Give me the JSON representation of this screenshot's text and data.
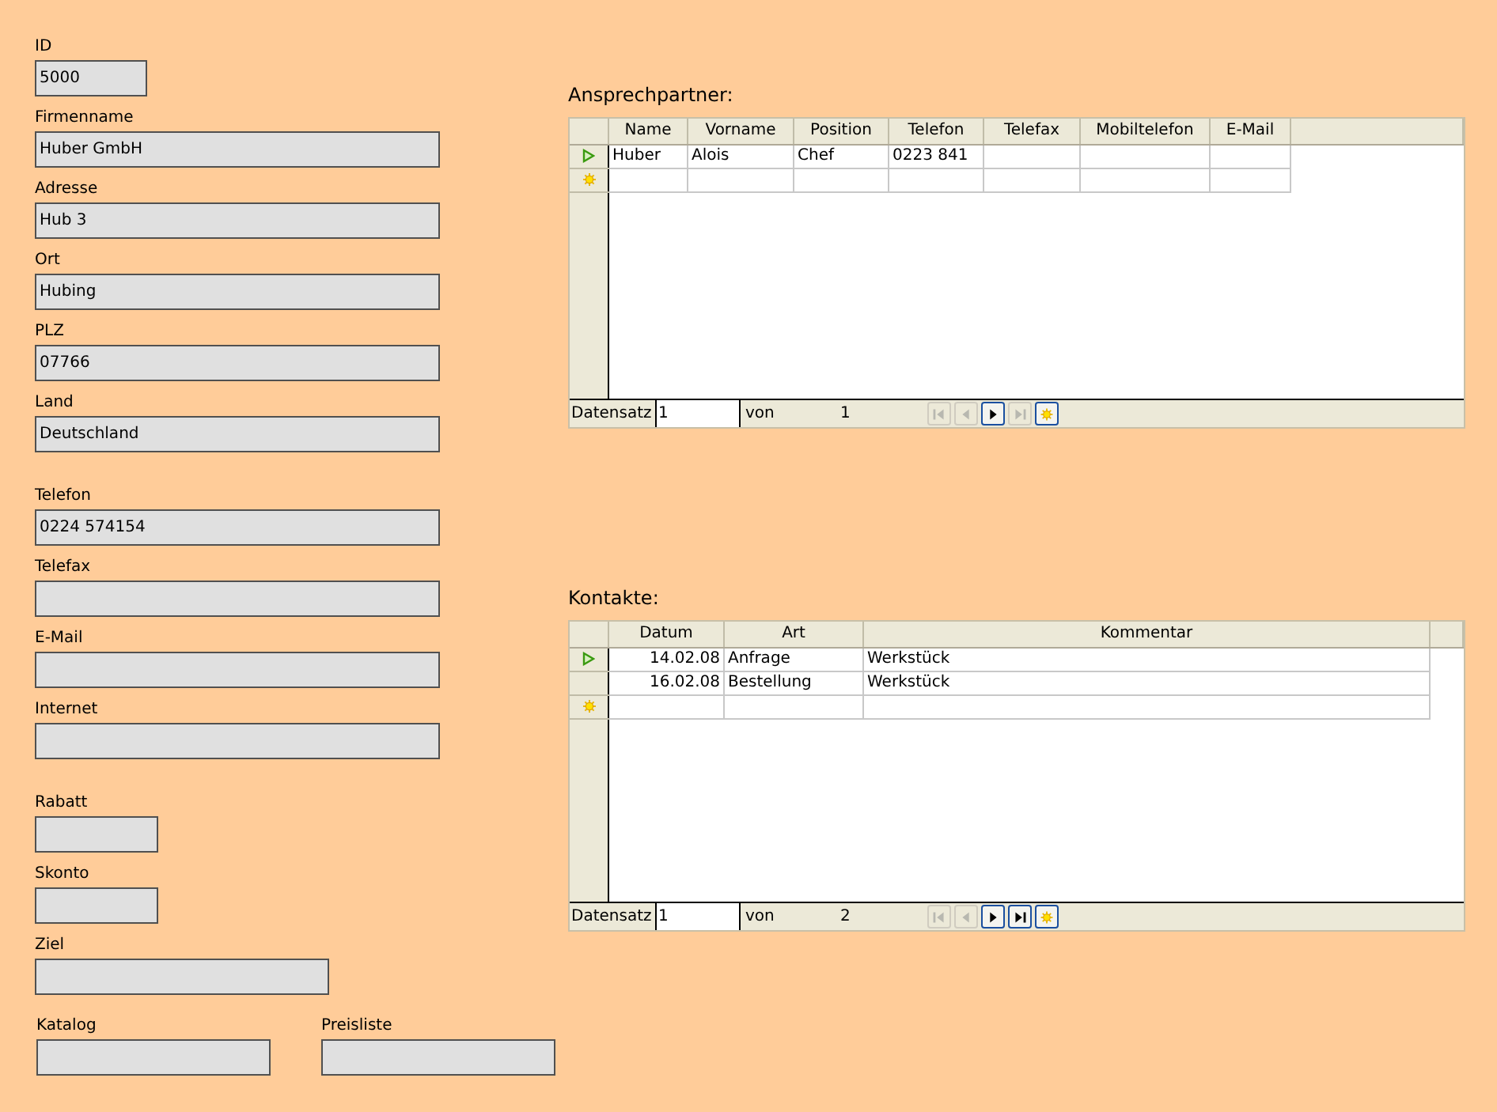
{
  "form_sections": [
    {
      "rows": [
        [
          {
            "label": "ID",
            "value": "5000",
            "kind": "short"
          }
        ],
        [
          {
            "label": "Firmenname",
            "value": "Huber GmbH",
            "kind": "long"
          }
        ],
        [
          {
            "label": "Adresse",
            "value": "Hub 3",
            "kind": "long"
          }
        ],
        [
          {
            "label": "Ort",
            "value": "Hubing",
            "kind": "long"
          }
        ],
        [
          {
            "label": "PLZ",
            "value": "07766",
            "kind": "long"
          }
        ],
        [
          {
            "label": "Land",
            "value": "Deutschland",
            "kind": "long"
          }
        ]
      ]
    },
    {
      "rows": [
        [
          {
            "label": "Telefon",
            "value": "0224 574154",
            "kind": "long"
          }
        ],
        [
          {
            "label": "Telefax",
            "kind": "long"
          }
        ],
        [
          {
            "label": "E-Mail",
            "kind": "long"
          }
        ],
        [
          {
            "label": "Internet",
            "kind": "long"
          }
        ]
      ]
    },
    {
      "rows": [
        [
          {
            "label": "Rabatt",
            "kind": "tiny"
          }
        ],
        [
          {
            "label": "Skonto",
            "kind": "tiny"
          }
        ],
        [
          {
            "label": "Ziel",
            "kind": "medium"
          }
        ]
      ]
    },
    {
      "rows": [
        [
          {
            "label": "Katalog",
            "kind": "half"
          },
          {
            "label": "Preisliste",
            "kind": "half"
          }
        ]
      ]
    }
  ],
  "subforms": [
    {
      "title": "Ansprechpartner:",
      "kind": "persons",
      "columns": [
        "Name",
        "Vorname",
        "Position",
        "Telefon",
        "Telefax",
        "Mobiltelefon",
        "E-Mail"
      ],
      "rows": [
        {
          "kind": "current",
          "cells": [
            "Huber",
            "Alois",
            "Chef",
            "0223 841"
          ]
        },
        {
          "kind": "new",
          "cells": []
        }
      ],
      "navigator": {
        "label": "Datensatz",
        "record": "1",
        "of_label": "von",
        "count": "1",
        "buttons": [
          {
            "kind": "first",
            "disabled": true
          },
          {
            "kind": "prev",
            "disabled": true
          },
          {
            "kind": "next",
            "disabled": false
          },
          {
            "kind": "last",
            "disabled": true
          },
          {
            "kind": "new",
            "disabled": false
          }
        ]
      }
    },
    {
      "title": "Kontakte:",
      "kind": "contacts",
      "columns": [
        "Datum",
        "Art",
        "Kommentar"
      ],
      "rows": [
        {
          "kind": "current",
          "cells": [
            "14.02.08",
            "Anfrage",
            "Werkstück"
          ]
        },
        {
          "kind": "plain",
          "cells": [
            "16.02.08",
            "Bestellung",
            "Werkstück"
          ]
        },
        {
          "kind": "new",
          "cells": []
        }
      ],
      "navigator": {
        "label": "Datensatz",
        "record": "1",
        "of_label": "von",
        "count": "2",
        "buttons": [
          {
            "kind": "first",
            "disabled": true
          },
          {
            "kind": "prev",
            "disabled": true
          },
          {
            "kind": "next",
            "disabled": false
          },
          {
            "kind": "last",
            "disabled": false
          },
          {
            "kind": "new",
            "disabled": false
          }
        ]
      }
    }
  ]
}
